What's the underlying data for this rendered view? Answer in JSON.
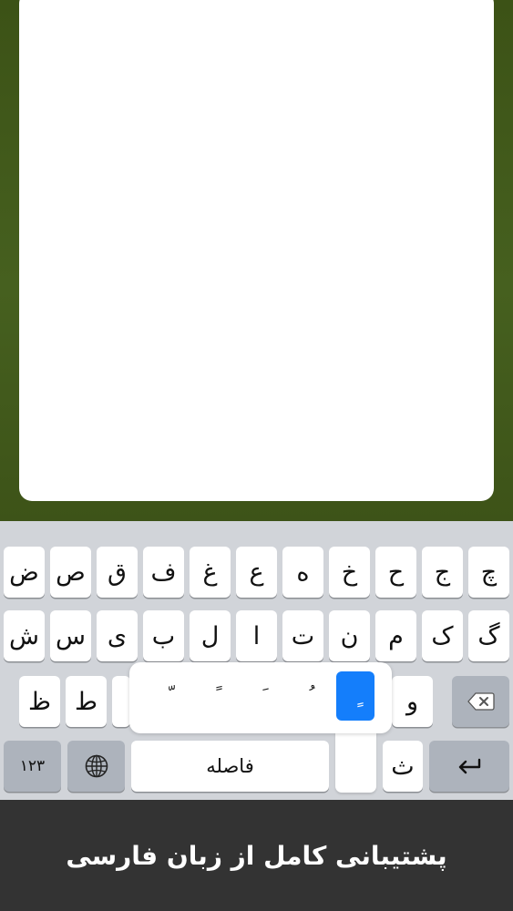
{
  "keyboard": {
    "row1": [
      "چ",
      "ج",
      "ح",
      "خ",
      "ه",
      "ع",
      "غ",
      "ف",
      "ق",
      "ص",
      "ض"
    ],
    "row2": [
      "گ",
      "ک",
      "م",
      "ن",
      "ت",
      "ا",
      "ل",
      "ب",
      "ی",
      "س",
      "ش"
    ],
    "row3": [
      "و",
      "ط",
      "ظ"
    ],
    "popup": [
      "ٍ",
      "ُ",
      "َ",
      "ً",
      "ّ"
    ],
    "bottom": {
      "numbers_label": "۱۲۳",
      "space_label": "فاصله",
      "key_label": "ث"
    },
    "icons": {
      "delete": "delete-icon",
      "globe": "globe-icon",
      "return": "return-icon"
    }
  },
  "caption": {
    "text": "پشتیبانی کامل از زبان فارسی"
  },
  "colors": {
    "background_green": "#3c5216",
    "keyboard_bg": "#d1d4d9",
    "selected_option": "#147efb",
    "caption_bg": "#333333"
  }
}
